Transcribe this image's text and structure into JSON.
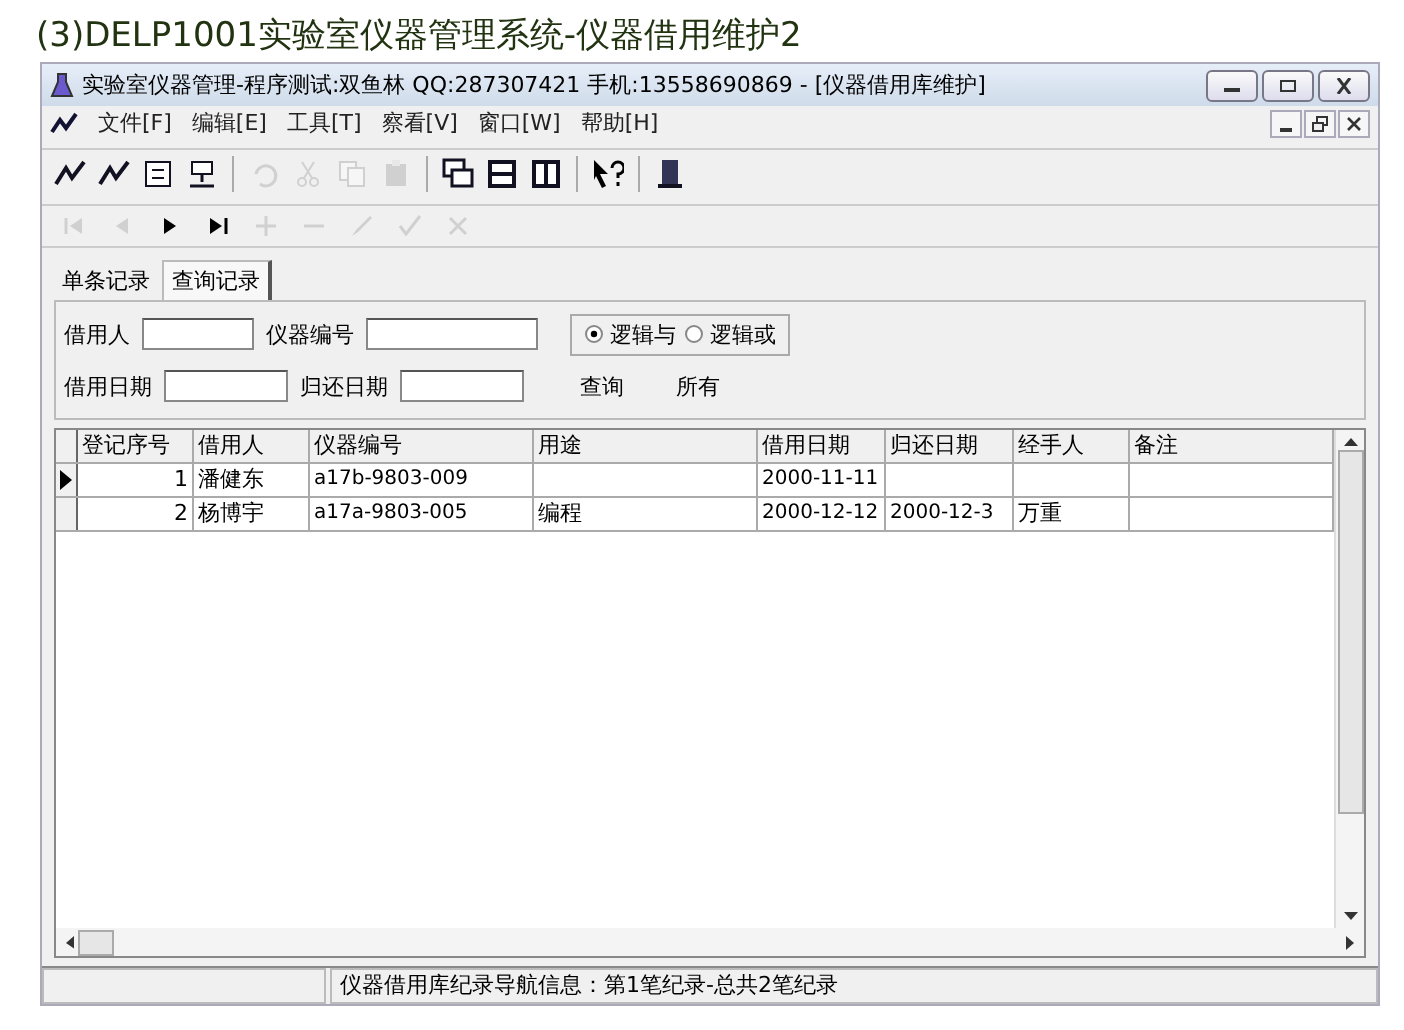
{
  "caption": "(3)DELP1001实验室仪器管理系统-仪器借用维护2",
  "window": {
    "title": "实验室仪器管理-程序测试:双鱼林  QQ:287307421 手机:13558690869 - [仪器借用库维护]"
  },
  "menu": [
    {
      "label": "文件[F]"
    },
    {
      "label": "编辑[E]"
    },
    {
      "label": "工具[T]"
    },
    {
      "label": "察看[V]"
    },
    {
      "label": "窗口[W]"
    },
    {
      "label": "帮助[H]"
    }
  ],
  "toolbar": [
    {
      "kind": "app",
      "disabled": false
    },
    {
      "kind": "app2",
      "disabled": false
    },
    {
      "kind": "calc",
      "disabled": false
    },
    {
      "kind": "net",
      "disabled": false
    },
    {
      "kind": "sep"
    },
    {
      "kind": "undo",
      "disabled": true
    },
    {
      "kind": "cut",
      "disabled": true
    },
    {
      "kind": "copy",
      "disabled": true
    },
    {
      "kind": "paste",
      "disabled": true
    },
    {
      "kind": "sep"
    },
    {
      "kind": "cascade",
      "disabled": false
    },
    {
      "kind": "hsplit",
      "disabled": false
    },
    {
      "kind": "vsplit",
      "disabled": false
    },
    {
      "kind": "sep"
    },
    {
      "kind": "help",
      "disabled": false
    },
    {
      "kind": "sep"
    },
    {
      "kind": "exit",
      "disabled": false
    }
  ],
  "navigator": [
    {
      "kind": "first",
      "disabled": true
    },
    {
      "kind": "prior",
      "disabled": true
    },
    {
      "kind": "next",
      "disabled": false
    },
    {
      "kind": "last",
      "disabled": false
    },
    {
      "kind": "insert",
      "disabled": true
    },
    {
      "kind": "delete",
      "disabled": true
    },
    {
      "kind": "edit",
      "disabled": true
    },
    {
      "kind": "post",
      "disabled": true
    },
    {
      "kind": "cancel",
      "disabled": true
    }
  ],
  "tabs": [
    {
      "label": "单条记录",
      "selected": false
    },
    {
      "label": "查询记录",
      "selected": true
    }
  ],
  "filters": {
    "borrower_label": "借用人",
    "instrument_label": "仪器编号",
    "borrow_date_label": "借用日期",
    "return_date_label": "归还日期",
    "query": "查询",
    "all": "所有",
    "logic": [
      {
        "label": "逻辑与",
        "selected": true
      },
      {
        "label": "逻辑或",
        "selected": false
      }
    ]
  },
  "table": {
    "columns": [
      "登记序号",
      "借用人",
      "仪器编号",
      "用途",
      "借用日期",
      "归还日期",
      "经手人",
      "备注"
    ],
    "rows": [
      {
        "current": true,
        "cells": [
          "1",
          "潘健东",
          "a17b-9803-009",
          "",
          "2000-11-11",
          "",
          "",
          ""
        ]
      },
      {
        "current": false,
        "cells": [
          "2",
          "杨博宇",
          "a17a-9803-005",
          "编程",
          "2000-12-12",
          "2000-12-3",
          "万重",
          ""
        ]
      }
    ]
  },
  "status_bar": "仪器借用库纪录导航信息：第1笔纪录-总共2笔纪录"
}
